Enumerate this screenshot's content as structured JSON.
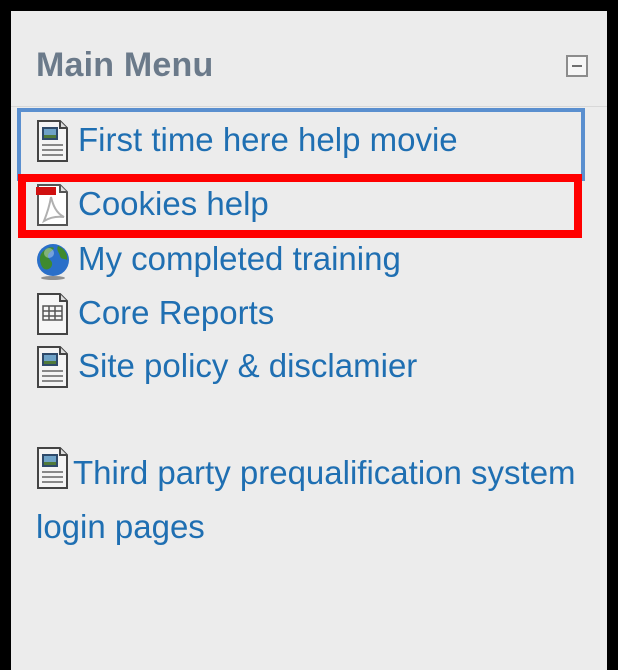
{
  "block": {
    "title": "Main Menu",
    "collapse_icon": "collapse-minus-icon"
  },
  "menu": {
    "items": [
      {
        "label": "First time here help movie",
        "icon": "video-file-icon"
      },
      {
        "label": "Cookies help",
        "icon": "pdf-file-icon"
      },
      {
        "label": "My completed training",
        "icon": "globe-icon"
      },
      {
        "label": "Core Reports",
        "icon": "spreadsheet-file-icon"
      },
      {
        "label": "Site policy & disclamier",
        "icon": "video-file-icon"
      },
      {
        "label": "Third party prequalification system login pages",
        "icon": "video-file-icon"
      }
    ]
  },
  "highlights": {
    "blue_color": "#5a8fcf",
    "red_color": "#ff0000"
  },
  "colors": {
    "link": "#1f6fb2",
    "title": "#6b7a8a",
    "background": "#ececec"
  }
}
